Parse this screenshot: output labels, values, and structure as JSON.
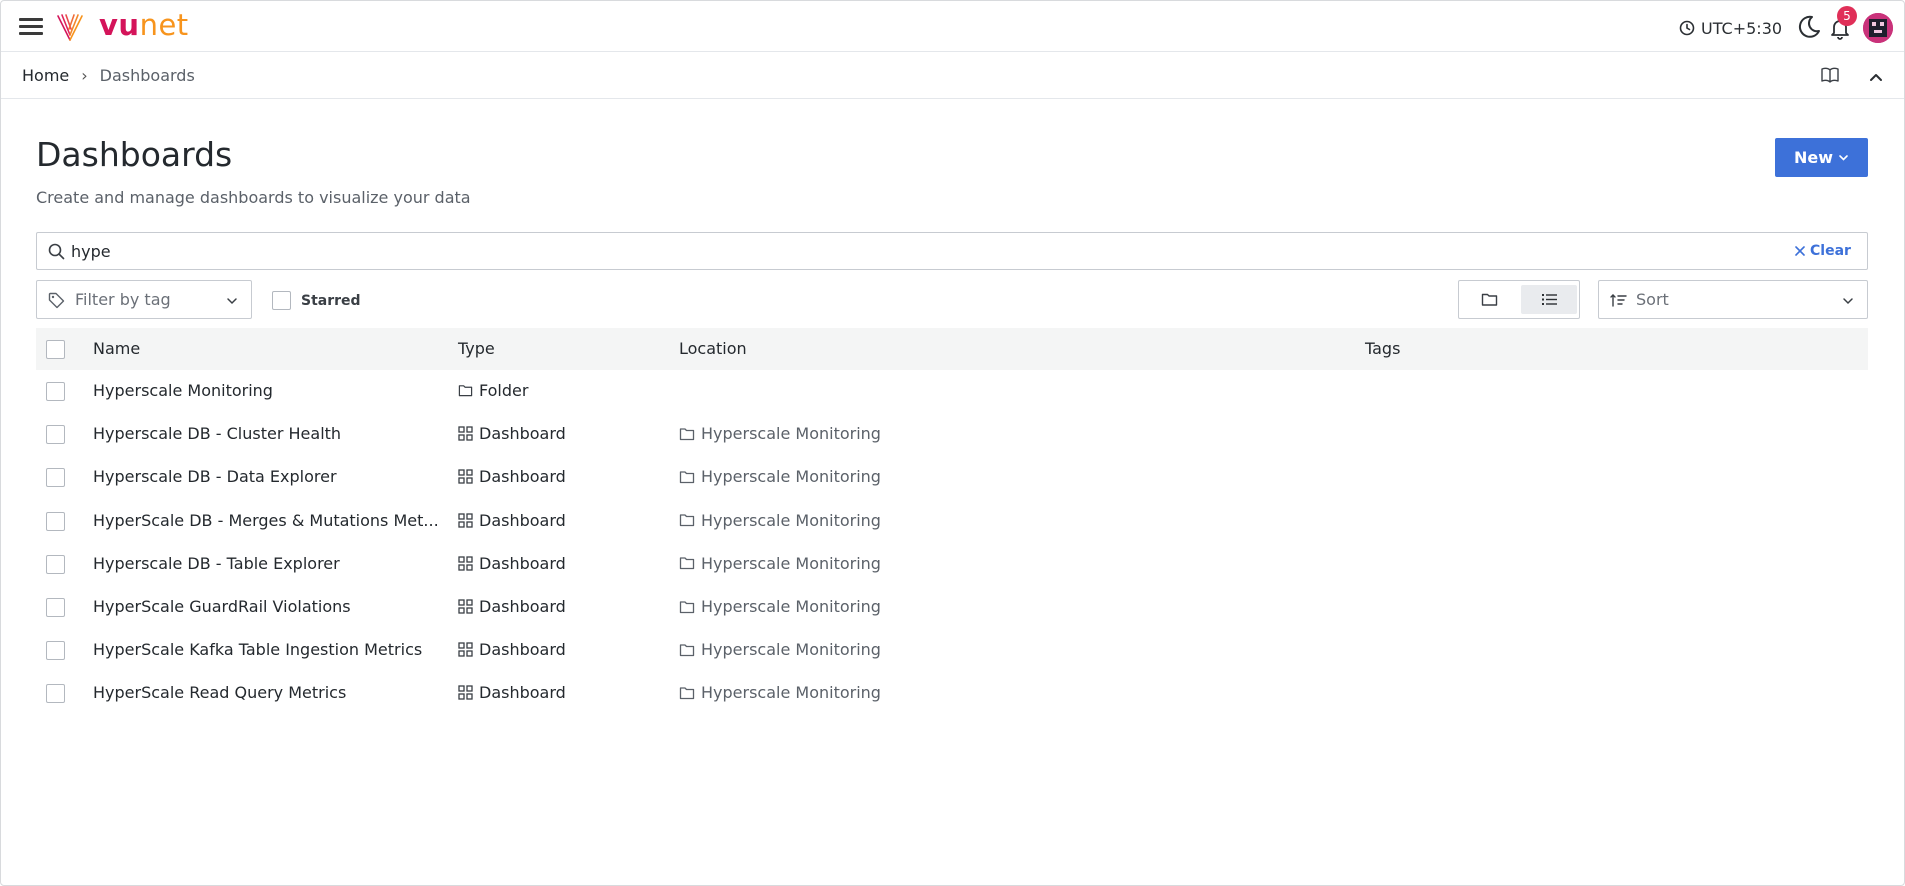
{
  "topbar": {
    "logo_vu": "vu",
    "logo_net": "net",
    "timezone": "UTC+5:30",
    "notification_count": "5"
  },
  "breadcrumb": {
    "home": "Home",
    "separator": "›",
    "current": "Dashboards"
  },
  "header": {
    "title": "Dashboards",
    "subtitle": "Create and manage dashboards to visualize your data",
    "new_button": "New"
  },
  "search": {
    "value": "hype",
    "clear_label": "Clear"
  },
  "filters": {
    "tag_placeholder": "Filter by tag",
    "starred_label": "Starred",
    "sort_placeholder": "Sort"
  },
  "table": {
    "columns": [
      "Name",
      "Type",
      "Location",
      "Tags"
    ],
    "rows": [
      {
        "name": "Hyperscale Monitoring",
        "type": "Folder",
        "type_icon": "folder-icon",
        "location": ""
      },
      {
        "name": "Hyperscale DB - Cluster Health",
        "type": "Dashboard",
        "type_icon": "dashboard-grid-icon",
        "location": "Hyperscale Monitoring"
      },
      {
        "name": "Hyperscale DB - Data Explorer",
        "type": "Dashboard",
        "type_icon": "dashboard-grid-icon",
        "location": "Hyperscale Monitoring"
      },
      {
        "name": "HyperScale DB - Merges & Mutations Met...",
        "type": "Dashboard",
        "type_icon": "dashboard-grid-icon",
        "location": "Hyperscale Monitoring"
      },
      {
        "name": "Hyperscale DB - Table Explorer",
        "type": "Dashboard",
        "type_icon": "dashboard-grid-icon",
        "location": "Hyperscale Monitoring"
      },
      {
        "name": "HyperScale GuardRail Violations",
        "type": "Dashboard",
        "type_icon": "dashboard-grid-icon",
        "location": "Hyperscale Monitoring"
      },
      {
        "name": "HyperScale Kafka Table Ingestion Metrics",
        "type": "Dashboard",
        "type_icon": "dashboard-grid-icon",
        "location": "Hyperscale Monitoring"
      },
      {
        "name": "HyperScale Read Query Metrics",
        "type": "Dashboard",
        "type_icon": "dashboard-grid-icon",
        "location": "Hyperscale Monitoring"
      }
    ]
  },
  "colors": {
    "primary": "#3d71d9",
    "brand_pink": "#d4145a",
    "brand_orange": "#f7941d",
    "badge": "#e02f58"
  }
}
